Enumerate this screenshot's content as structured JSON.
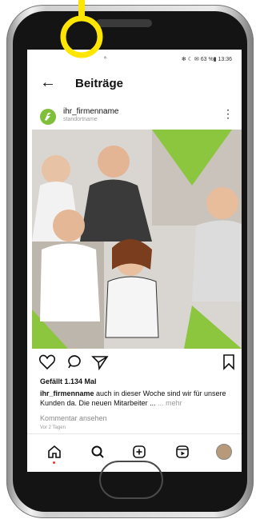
{
  "status": {
    "signal": "⁸ ",
    "right": "✻ ☾ ✉ 63 %▮ 13:36"
  },
  "header": {
    "back_glyph": "←",
    "title": "Beiträge"
  },
  "post": {
    "username": "ihr_firmenname",
    "location": "standortname",
    "menu_glyph": "⋮",
    "likes": "Gefällt 1.134 Mal",
    "caption_user": "ihr_firmenname",
    "caption_text": "auch in dieser Woche sind wir für unsere Kunden da. Die neuen Mitarbeiter ... ",
    "caption_more": "... mehr",
    "view_comments": "Kommentar ansehen",
    "time": "Vor 2 Tagen"
  },
  "icons": {
    "heart": "heart-icon",
    "comment": "comment-icon",
    "share": "share-icon",
    "bookmark": "bookmark-icon",
    "home": "home-icon",
    "search": "search-icon",
    "add": "add-icon",
    "reels": "reels-icon",
    "profile": "profile-icon"
  },
  "colors": {
    "accent": "#7fbf3a",
    "highlight": "#ffe600",
    "notification": "#e53935"
  }
}
